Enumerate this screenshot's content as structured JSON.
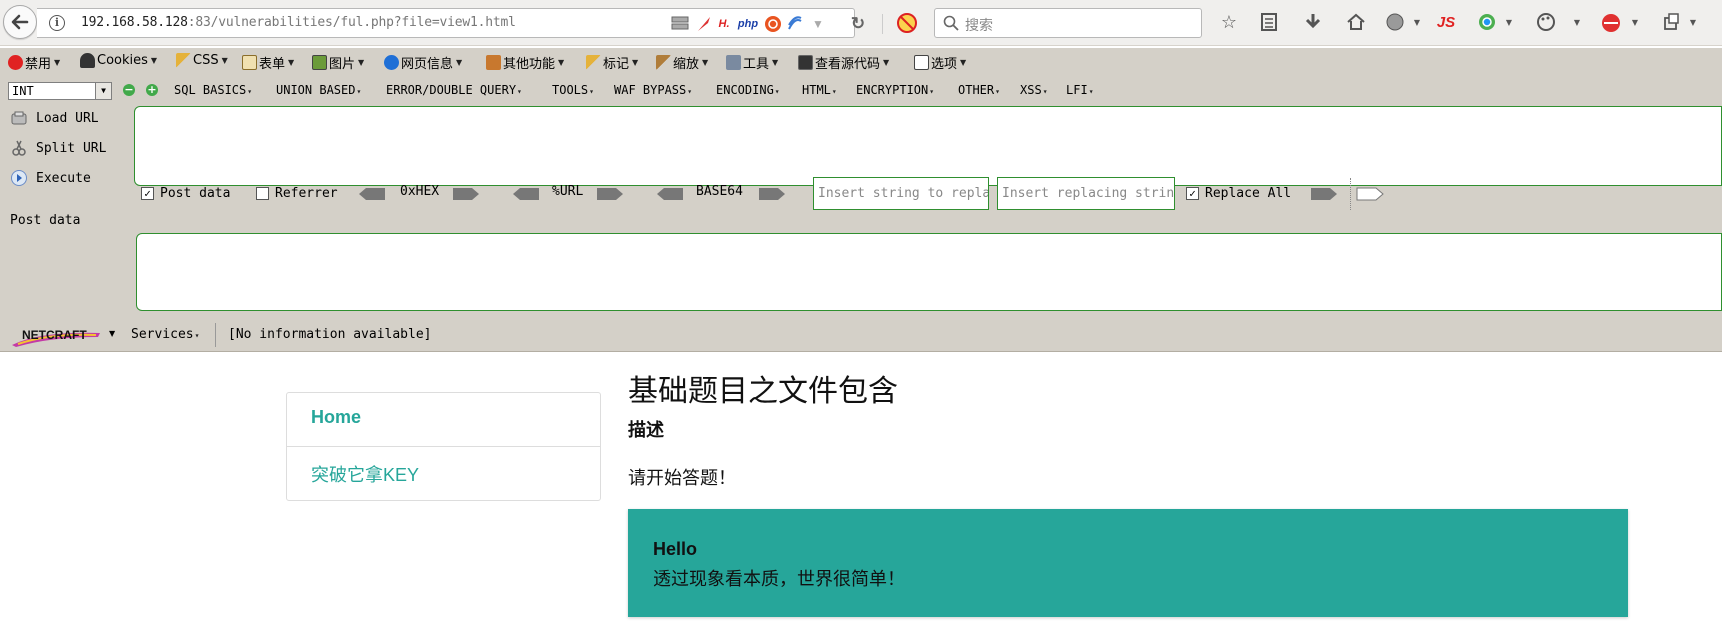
{
  "browser": {
    "url_host": "192.168.58.128",
    "url_rest": ":83/vulnerabilities/ful.php?file=view1.html",
    "search_placeholder": "搜索",
    "toolbar_icons": [
      "bookmark-star-icon",
      "reading-list-icon",
      "download-icon",
      "home-icon",
      "globe-icon",
      "js-icon",
      "chrome-ext-icon",
      "palette-icon",
      "hackbar-red-icon",
      "screenshot-icon"
    ],
    "url_icons": {
      "php": "php",
      "php_h": "H."
    }
  },
  "menubar": {
    "items": [
      "禁用",
      "Cookies",
      "CSS",
      "表单",
      "图片",
      "网页信息",
      "其他功能",
      "标记",
      "缩放",
      "工具",
      "查看源代码",
      "选项"
    ]
  },
  "hackbar": {
    "type_value": "INT",
    "menus": [
      "SQL BASICS",
      "UNION BASED",
      "ERROR/DOUBLE QUERY",
      "TOOLS",
      "WAF BYPASS",
      "ENCODING",
      "HTML",
      "ENCRYPTION",
      "OTHER",
      "XSS",
      "LFI"
    ],
    "actions": {
      "load": "Load URL",
      "split": "Split URL",
      "execute": "Execute"
    },
    "options": {
      "post_data": "Post data",
      "post_data_checked": true,
      "referrer": "Referrer",
      "referrer_checked": false,
      "hex": "0xHEX",
      "url": "%URL",
      "base64": "BASE64",
      "replace_placeholder": "Insert string to replace",
      "replacing_placeholder": "Insert replacing string",
      "replace_all": "Replace All",
      "replace_all_checked": true
    },
    "post_data_label": "Post data",
    "url_value": "",
    "post_value": ""
  },
  "netcraft": {
    "logo_text": "NETCRAFT",
    "services": "Services",
    "info": "[No information available]"
  },
  "page": {
    "nav": [
      {
        "label": "Home"
      },
      {
        "label": "突破它拿KEY"
      }
    ],
    "title": "基础题目之文件包含",
    "desc_heading": "描述",
    "desc_text": "请开始答题！",
    "card_title": "Hello",
    "card_text": "透过现象看本质，世界很简单！",
    "accent_color": "#26a69a"
  }
}
